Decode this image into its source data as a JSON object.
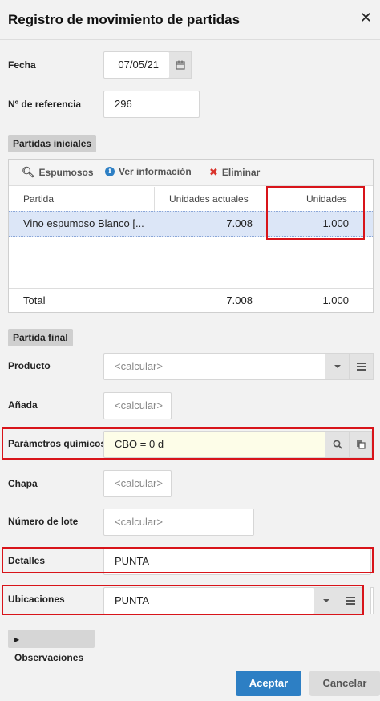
{
  "dialog": {
    "title": "Registro de movimiento de partidas",
    "close": "✕"
  },
  "fields": {
    "fecha_label": "Fecha",
    "fecha_value": "07/05/21",
    "ref_label": "Nº de referencia",
    "ref_value": "296"
  },
  "initial": {
    "section_label": "Partidas iniciales",
    "toolbar": {
      "search": "Espumosos",
      "info": "Ver información",
      "delete": "Eliminar"
    },
    "columns": [
      "Partida",
      "Unidades actuales",
      "Unidades"
    ],
    "rows": [
      {
        "partida": "Vino espumoso Blanco [...",
        "actuales": "7.008",
        "unidades": "1.000"
      }
    ],
    "total_label": "Total",
    "total_actuales": "7.008",
    "total_unidades": "1.000"
  },
  "final": {
    "section_label": "Partida final",
    "producto_label": "Producto",
    "producto_value": "<calcular>",
    "anada_label": "Añada",
    "anada_value": "<calcular>",
    "parametros_label": "Parámetros químicos",
    "parametros_value": "CBO = 0 d",
    "chapa_label": "Chapa",
    "chapa_value": "<calcular>",
    "lote_label": "Número de lote",
    "lote_value": "<calcular>",
    "detalles_label": "Detalles",
    "detalles_value": "PUNTA",
    "ubicaciones_label": "Ubicaciones",
    "ubicaciones_value": "PUNTA"
  },
  "observaciones_label": "Observaciones",
  "buttons": {
    "accept": "Aceptar",
    "cancel": "Cancelar"
  },
  "colors": {
    "primary": "#2d7fc4",
    "highlight": "#d8141a",
    "selected_row": "#dce6f7",
    "param_bg": "#fdfde8"
  }
}
